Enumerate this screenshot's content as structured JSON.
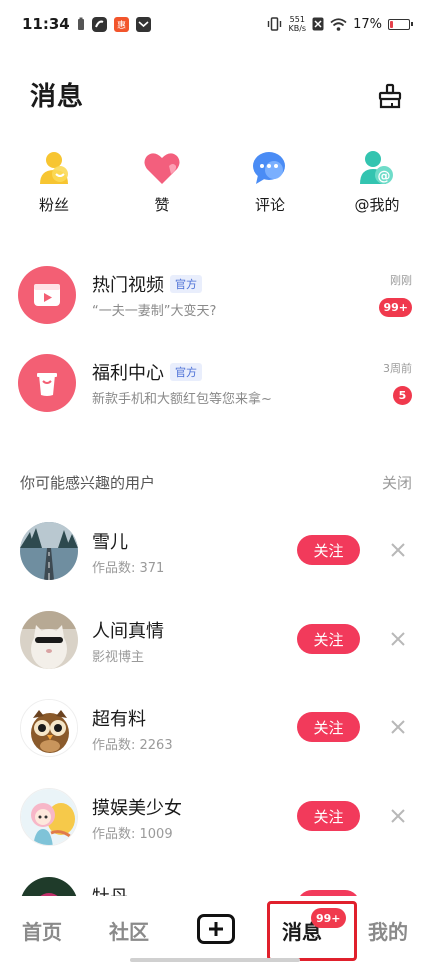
{
  "status_bar": {
    "time": "11:34",
    "net_speed_value": "551",
    "net_speed_unit": "KB/s",
    "battery": "17%",
    "battery_level": 0.17
  },
  "header": {
    "title": "消息",
    "clean_icon": "broom-icon"
  },
  "quick_entries": [
    {
      "label": "粉丝",
      "icon": "fans-icon",
      "color": "#f7c531"
    },
    {
      "label": "赞",
      "icon": "heart-icon",
      "color": "#f35f7d"
    },
    {
      "label": "评论",
      "icon": "comment-icon",
      "color": "#4a8cf5"
    },
    {
      "label": "@我的",
      "icon": "at-icon",
      "color": "#33c4b0"
    }
  ],
  "official_messages": [
    {
      "title": "热门视频",
      "tag": "官方",
      "subtitle": "“一夫一妻制”大变天?",
      "time": "刚刚",
      "badge": "99+",
      "icon": "video-icon"
    },
    {
      "title": "福利中心",
      "tag": "官方",
      "subtitle": "新款手机和大额红包等您来拿~",
      "time": "3周前",
      "badge": "5",
      "icon": "gift-bag-icon"
    }
  ],
  "suggestions": {
    "title": "你可能感兴趣的用户",
    "close_label": "关闭",
    "follow_label": "关注",
    "users": [
      {
        "name": "雪儿",
        "sub": "作品数: 371",
        "avatar": "road-avatar"
      },
      {
        "name": "人间真情",
        "sub": "影视博主",
        "avatar": "cat-avatar"
      },
      {
        "name": "超有料",
        "sub": "作品数: 2263",
        "avatar": "owl-avatar"
      },
      {
        "name": "摸娱美少女",
        "sub": "作品数: 1009",
        "avatar": "anime-girl-avatar"
      },
      {
        "name": "牡丹",
        "sub": "",
        "avatar": "peony-avatar"
      }
    ]
  },
  "bottom_nav": {
    "items": [
      {
        "label": "首页",
        "active": false
      },
      {
        "label": "社区",
        "active": false
      },
      {
        "label": "消息",
        "active": true,
        "badge": "99+"
      },
      {
        "label": "我的",
        "active": false
      }
    ],
    "plus_icon": "plus-icon"
  }
}
